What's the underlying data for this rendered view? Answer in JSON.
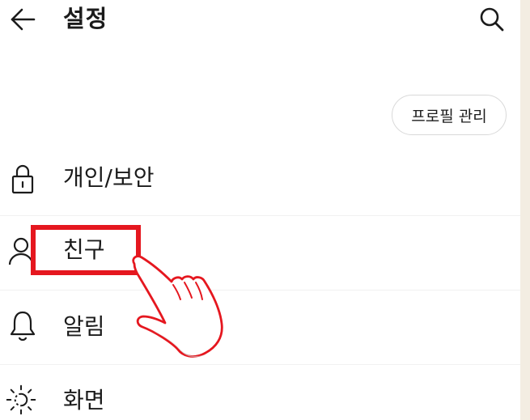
{
  "header": {
    "title": "설정"
  },
  "profile_button_label": "프로필 관리",
  "menu": {
    "items": [
      {
        "label": "개인/보안",
        "icon": "lock-icon"
      },
      {
        "label": "친구",
        "icon": "person-icon"
      },
      {
        "label": "알림",
        "icon": "bell-icon"
      },
      {
        "label": "화면",
        "icon": "sun-icon"
      }
    ]
  },
  "colors": {
    "highlight": "#e5171f",
    "background": "#ffffff",
    "outer_background": "#f3ede2",
    "text": "#1b1b1b"
  },
  "annotation": {
    "highlighted_item": "친구",
    "pointer_icon": "pointing-hand-icon"
  }
}
